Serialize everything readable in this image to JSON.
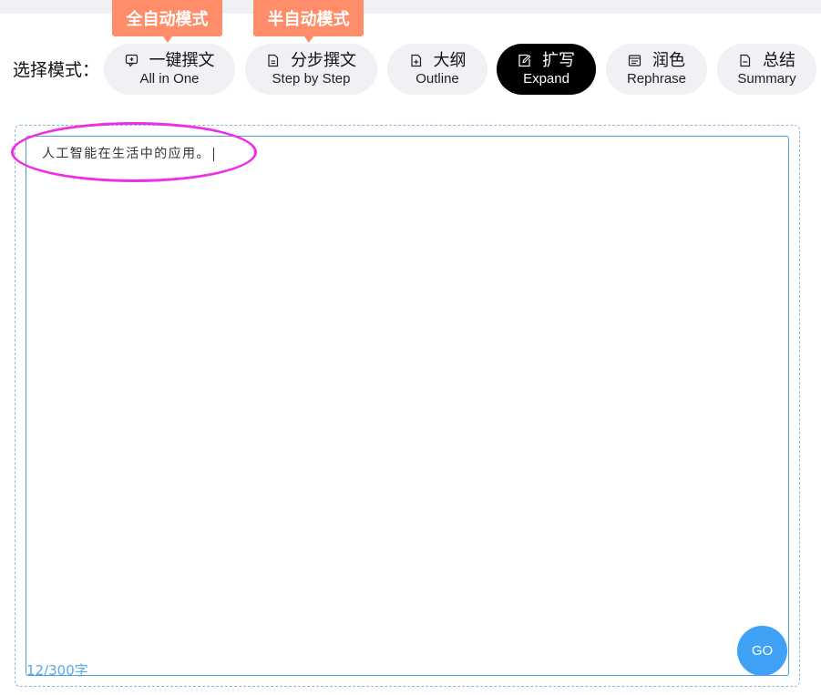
{
  "mode_selector": {
    "label": "选择模式：",
    "tags": {
      "full_auto": "全自动模式",
      "semi_auto": "半自动模式"
    },
    "modes": [
      {
        "cn": "一键撰文",
        "en": "All in One",
        "icon": "chat-doc-icon",
        "active": false
      },
      {
        "cn": "分步撰文",
        "en": "Step by Step",
        "icon": "document-icon",
        "active": false
      },
      {
        "cn": "大纲",
        "en": "Outline",
        "icon": "document-plus-icon",
        "active": false
      },
      {
        "cn": "扩写",
        "en": "Expand",
        "icon": "edit-icon",
        "active": true
      },
      {
        "cn": "润色",
        "en": "Rephrase",
        "icon": "list-doc-icon",
        "active": false
      },
      {
        "cn": "总结",
        "en": "Summary",
        "icon": "document-minus-icon",
        "active": false
      }
    ]
  },
  "editor": {
    "input_value": "人工智能在生活中的应用。",
    "char_count": "12/300字",
    "submit_label": "GO"
  },
  "colors": {
    "tag_orange": "#ff8d69",
    "active_mode_bg": "#000000",
    "inactive_mode_bg": "#f0f1f4",
    "accent_blue": "#3fa2f7",
    "highlight_magenta": "#ee2ee8"
  }
}
